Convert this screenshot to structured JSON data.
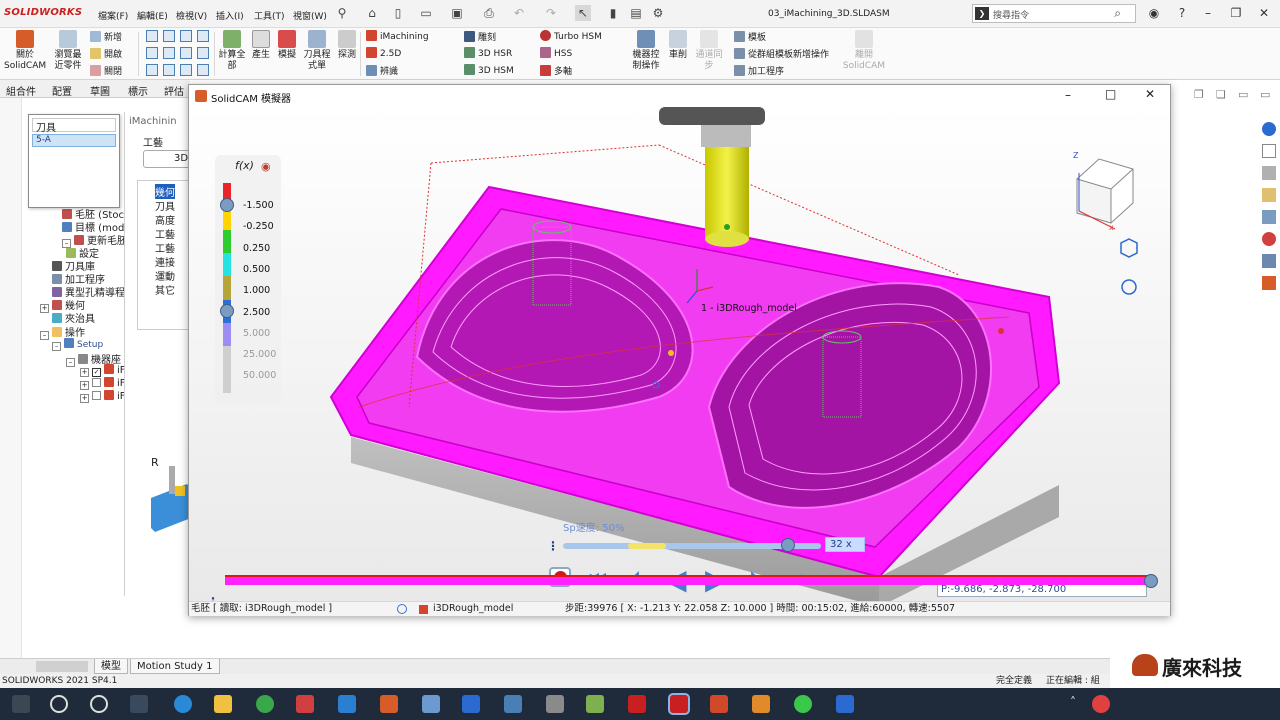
{
  "app": {
    "brand": "SOLIDWORKS",
    "document_title": "03_iMachining_3D.SLDASM",
    "menus": [
      "檔案(F)",
      "編輯(E)",
      "檢視(V)",
      "插入(I)",
      "工具(T)",
      "視窗(W)"
    ],
    "search_placeholder": "搜尋指令"
  },
  "ribbon": {
    "solidcam": "關於\nSolidCAM",
    "browse": "瀏覽最\n近零件",
    "file_new": "新增",
    "file_open": "開啟",
    "file_close": "關閉",
    "calc_all": "計算全\n部",
    "generate": "產生",
    "template": "模擬",
    "tool_sheet": "刀具程\n式單",
    "probe": "探測",
    "imachining": "iMachining",
    "d25": "2.5D",
    "turning": "辨識",
    "engrave": "雕刻",
    "hsr": "3D HSR",
    "hsm": "3D HSM",
    "turbo": "Turbo HSM",
    "hss": "HSS",
    "multiaxis": "多軸",
    "machine_ctrl": "機器控\n制操作",
    "single": "車削",
    "sync": "通道同\n步",
    "tmpl": "模板",
    "from_template": "從群組模板新增操作",
    "process": "加工程序",
    "disconnect": "離開\nSolidCAM"
  },
  "cmd_tabs": [
    "組合件",
    "配置",
    "草圖",
    "標示",
    "評估"
  ],
  "tool_popup": {
    "header": "刀具",
    "selected": "5-A"
  },
  "tree": {
    "items": [
      "毛胚 (Stoc",
      "目標 (mod",
      "更新毛胚",
      "設定",
      "刀具庫",
      "加工程序",
      "異型孔精導程",
      "幾何",
      "夾治具",
      "操作",
      "Setup",
      "機器座",
      "iF",
      "iF"
    ]
  },
  "imach_panel": {
    "title": "iMachinin",
    "section": "工藝",
    "btn": "3D",
    "items": [
      "幾何",
      "刀具",
      "高度",
      "工藝",
      "工藝",
      "連接",
      "運動",
      "其它"
    ],
    "letter": "R"
  },
  "simulator": {
    "title": "SolidCAM 模擬器",
    "legend_fx": "f(x)",
    "legend_values": [
      "-1.500",
      "-0.250",
      "0.250",
      "0.500",
      "1.000",
      "2.500",
      "5.000",
      "25.000",
      "50.000"
    ],
    "legend_colors": [
      "#e8262a",
      "#ffd400",
      "#2ecc2e",
      "#25e3e3",
      "#b5a53a",
      "#2d6fd6",
      "#9c8ef0",
      "#cfcfcf",
      "#cfcfcf"
    ],
    "tool_label": "1 - i3DRough_model",
    "speed_label": "Sp速度: 50%",
    "speed_level": 0.5,
    "speed_badge": "32 x",
    "coord": "P:-9.686, -2.873, -28.700",
    "progress": 1.0,
    "status_left": "毛胚 [ 讀取: i3DRough_model ]",
    "status_op": "i3DRough_model",
    "status_right": "步距:39976 [ X: -1.213 Y: 22.058 Z: 10.000 ] 時間: 00:15:02, 進給:60000, 轉速:5507"
  },
  "bottom_tabs": [
    "模型",
    "Motion Study 1"
  ],
  "statusbar": {
    "left": "SOLIDWORKS 2021 SP4.1",
    "right1": "完全定義",
    "right2": "正在編輯 : 組"
  },
  "logo_text": "廣來科技",
  "colors": {
    "magenta": "#ff1aff",
    "accent_red": "#cc2020",
    "taskbar": "#1f2b3a"
  }
}
